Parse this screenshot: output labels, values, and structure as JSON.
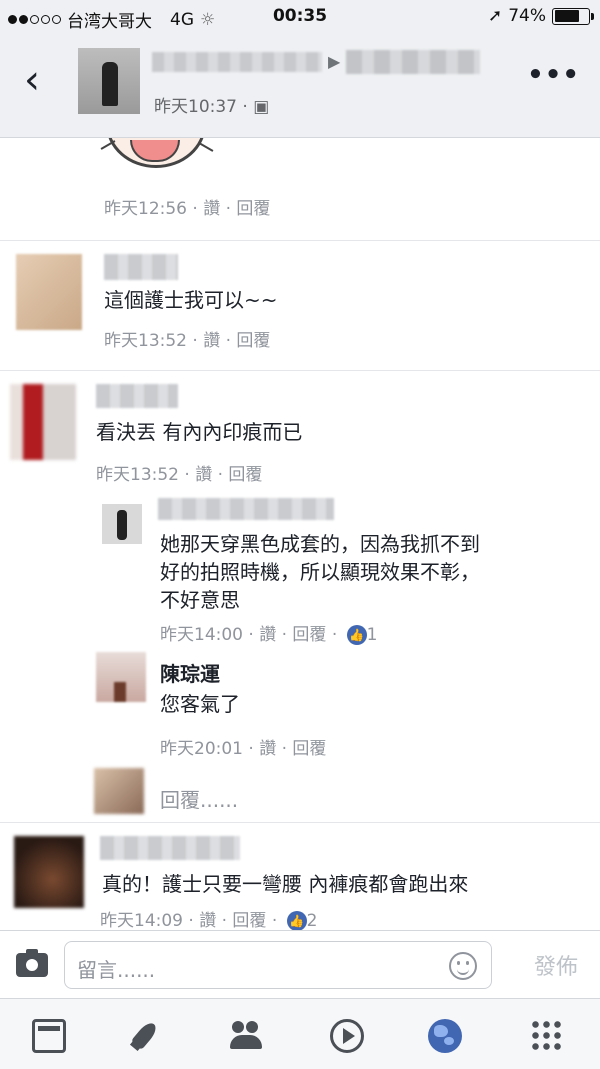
{
  "status_bar": {
    "carrier": "台湾大哥大",
    "network": "4G",
    "time": "00:35",
    "battery": "74%",
    "battery_level": 0.74
  },
  "header": {
    "timestamp": "昨天10:37 · ",
    "back_icon": "chevron-left-icon",
    "more_icon": "more-horizontal-icon"
  },
  "comments": [
    {
      "meta": "昨天12:56 · 讚 · 回覆"
    },
    {
      "text": "這個護士我可以~~",
      "meta": "昨天13:52 · 讚 · 回覆"
    },
    {
      "text": "看決丟 有內內印痕而已",
      "meta": "昨天13:52 · 讚 · 回覆"
    },
    {
      "text_lines": [
        "她那天穿黑色成套的，因為我抓不到",
        "好的拍照時機，所以顯現效果不彰，",
        "不好意思"
      ],
      "meta": "昨天14:00 · 讚 · 回覆 · ",
      "likes": "1"
    },
    {
      "name": "陳琮運",
      "text": "您客氣了",
      "meta": "昨天20:01 · 讚 · 回覆"
    },
    {
      "reply_prompt": "回覆......"
    },
    {
      "text": "真的！護士只要一彎腰 內褲痕都會跑出來",
      "meta": "昨天14:09 · 讚 · 回覆 · ",
      "likes": "2"
    }
  ],
  "composer": {
    "placeholder": "留言......",
    "post_label": "發佈"
  },
  "colors": {
    "accent": "#4267b2",
    "meta_text": "#90949c"
  }
}
